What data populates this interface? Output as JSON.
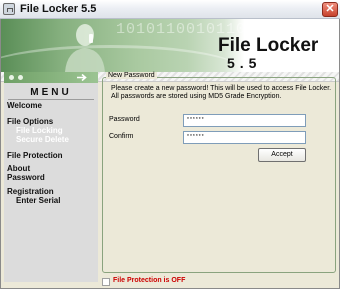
{
  "window": {
    "title": "File Locker 5.5",
    "close_glyph": "✕"
  },
  "banner": {
    "binary_text": "10101100101101000",
    "title": "File Locker",
    "version": "5.5"
  },
  "sidebar": {
    "heading": "MENU",
    "items": [
      {
        "label": "Welcome",
        "state": "normal"
      },
      {
        "label": "File Options",
        "state": "normal"
      },
      {
        "label": "File Locking",
        "state": "disabled"
      },
      {
        "label": "Secure Delete",
        "state": "disabled"
      },
      {
        "label": "File Protection",
        "state": "normal"
      },
      {
        "label": "About",
        "state": "normal"
      },
      {
        "label": "Password",
        "state": "normal"
      },
      {
        "label": "Registration",
        "state": "normal"
      },
      {
        "label": "Enter Serial",
        "state": "normal"
      }
    ]
  },
  "new_password": {
    "group_label": "New Password",
    "intro_line1": "Please create a new password! This will be used to access File Locker.",
    "intro_line2": "All passwords are stored using MD5 Grade Encryption.",
    "password_label": "Password",
    "password_value": "******",
    "confirm_label": "Confirm",
    "confirm_value": "******",
    "accept_label": "Accept"
  },
  "footer": {
    "protection_status": "File Protection is OFF"
  },
  "colors": {
    "accent_green": "#86b07f",
    "status_red": "#cc0000"
  }
}
